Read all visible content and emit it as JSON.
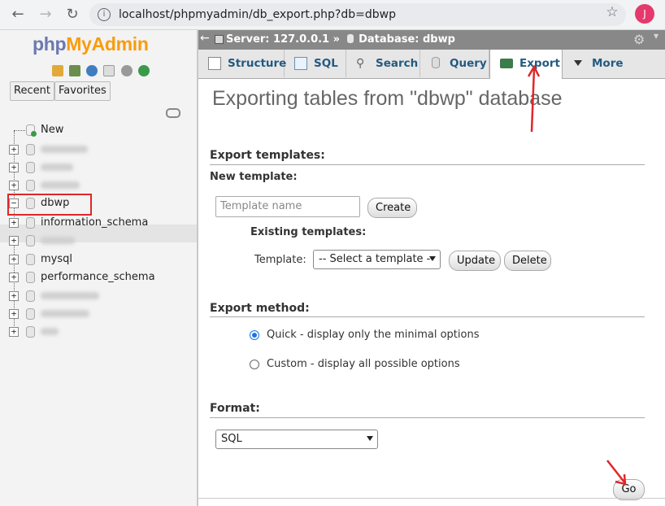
{
  "browser": {
    "url": "localhost/phpmyadmin/db_export.php?db=dbwp",
    "avatar_letter": "J"
  },
  "sidebar": {
    "logo_php": "php",
    "logo_myadmin": "MyAdmin",
    "tabs": [
      "Recent",
      "Favorites"
    ],
    "new_label": "New",
    "databases": [
      {
        "name": "",
        "blurred": true
      },
      {
        "name": "",
        "blurred": true
      },
      {
        "name": "",
        "blurred": true
      },
      {
        "name": "dbwp",
        "blurred": false,
        "selected": true
      },
      {
        "name": "information_schema",
        "blurred": false
      },
      {
        "name": "",
        "blurred": true
      },
      {
        "name": "mysql",
        "blurred": false
      },
      {
        "name": "performance_schema",
        "blurred": false
      },
      {
        "name": "",
        "blurred": true
      },
      {
        "name": "",
        "blurred": true
      },
      {
        "name": "",
        "blurred": true
      }
    ]
  },
  "breadcrumb": {
    "server": "Server: 127.0.0.1 »",
    "database": "Database: dbwp"
  },
  "tabs": [
    {
      "label": "Structure",
      "icon": "structure-icon"
    },
    {
      "label": "SQL",
      "icon": "sql-icon"
    },
    {
      "label": "Search",
      "icon": "search-icon"
    },
    {
      "label": "Query",
      "icon": "query-icon"
    },
    {
      "label": "Export",
      "icon": "export-icon",
      "active": true
    },
    {
      "label": "More",
      "icon": "chevron-down-icon"
    }
  ],
  "main": {
    "title": "Exporting tables from \"dbwp\" database",
    "templates": {
      "section_title": "Export templates:",
      "new_template_label": "New template:",
      "template_name_placeholder": "Template name",
      "create_label": "Create",
      "existing_label": "Existing templates:",
      "template_label": "Template:",
      "select_value": "-- Select a template --",
      "update_label": "Update",
      "delete_label": "Delete"
    },
    "method": {
      "section_title": "Export method:",
      "quick_label": "Quick - display only the minimal options",
      "custom_label": "Custom - display all possible options",
      "selected": "quick"
    },
    "format": {
      "section_title": "Format:",
      "value": "SQL"
    },
    "go_label": "Go"
  },
  "colors": {
    "annotation_red": "#e0262b",
    "tab_text": "#235a81",
    "server_bar": "#888888"
  }
}
